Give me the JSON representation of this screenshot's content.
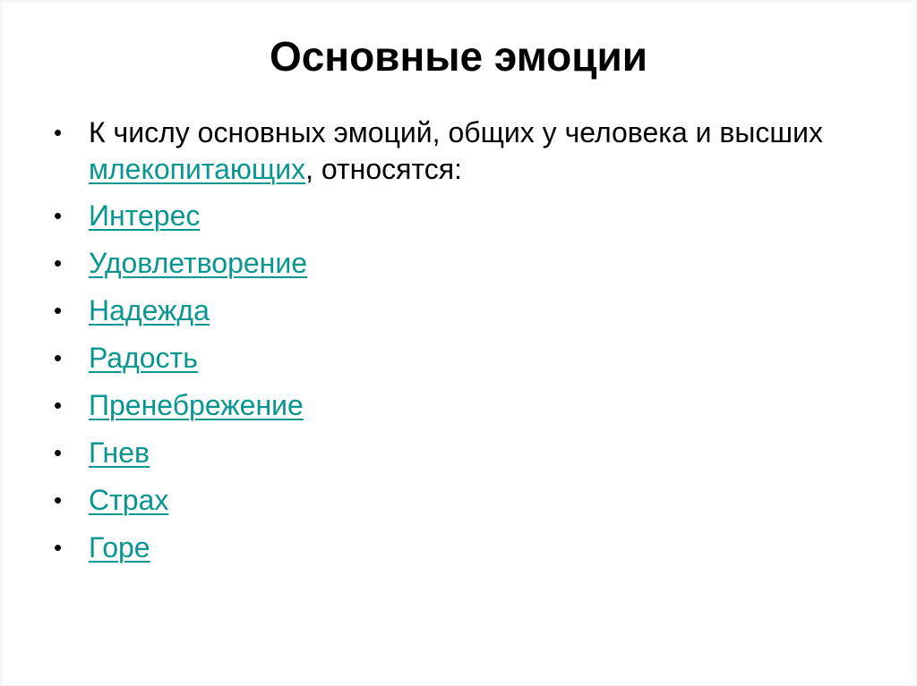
{
  "slide": {
    "title": "Основные эмоции",
    "intro": {
      "text_before": "К числу основных эмоций, общих у человека и высших ",
      "link_text": "млекопитающих",
      "text_after": ", относятся:"
    },
    "bullet_glyph": "•",
    "items": [
      {
        "label": "Интерес"
      },
      {
        "label": "Удовлетворение"
      },
      {
        "label": "Надежда"
      },
      {
        "label": "Радость"
      },
      {
        "label": "Пренебрежение"
      },
      {
        "label": "Гнев"
      },
      {
        "label": "Страх"
      },
      {
        "label": "Горе"
      }
    ],
    "colors": {
      "link": "#089690",
      "text": "#000000",
      "background": "#ffffff"
    }
  }
}
